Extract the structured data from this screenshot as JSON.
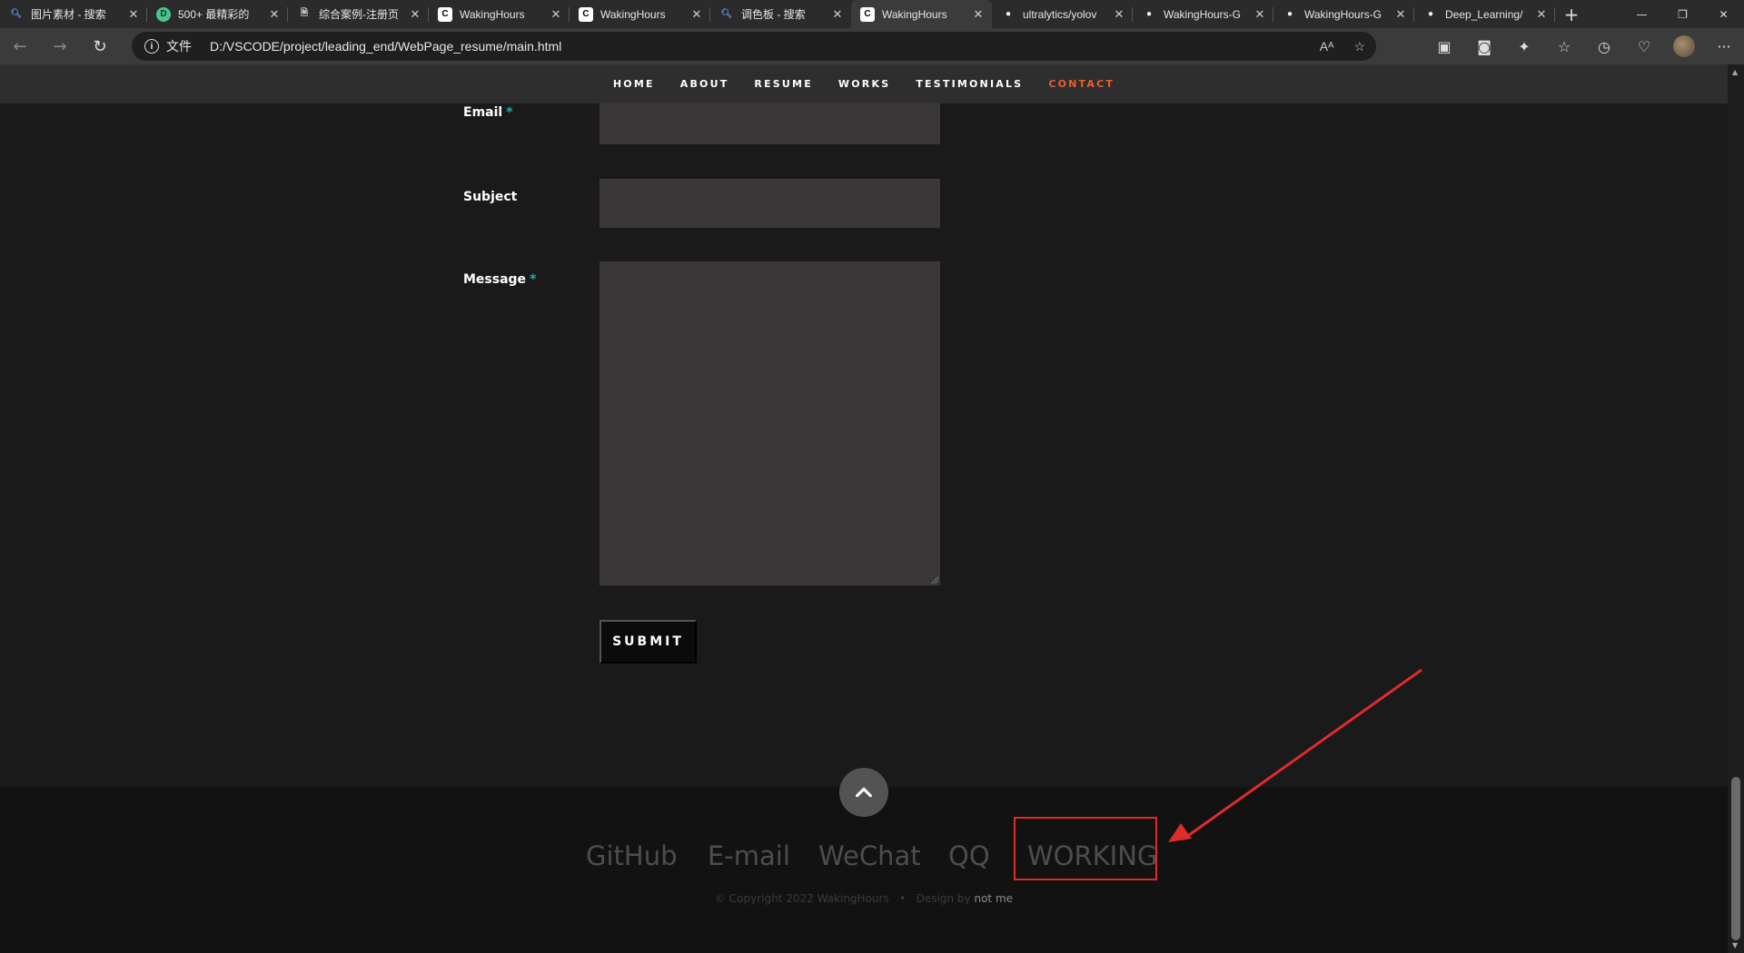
{
  "browser": {
    "tabs": [
      {
        "title": "图片素材 - 搜索",
        "icon": "search-icon"
      },
      {
        "title": "500+ 最精彩的",
        "icon": "d-icon"
      },
      {
        "title": "综合案例-注册页",
        "icon": "document-icon"
      },
      {
        "title": "WakingHours",
        "icon": "c-icon"
      },
      {
        "title": "WakingHours",
        "icon": "c-icon"
      },
      {
        "title": "调色板 - 搜索",
        "icon": "search-icon"
      },
      {
        "title": "WakingHours",
        "icon": "c-icon",
        "active": true
      },
      {
        "title": "ultralytics/yolov",
        "icon": "github-icon"
      },
      {
        "title": "WakingHours-G",
        "icon": "github-icon"
      },
      {
        "title": "WakingHours-G",
        "icon": "github-icon"
      },
      {
        "title": "Deep_Learning/",
        "icon": "github-icon"
      }
    ],
    "address": {
      "protocol_label": "文件",
      "url": "D:/VSCODE/project/leading_end/WebPage_resume/main.html"
    }
  },
  "nav": {
    "items": [
      "HOME",
      "ABOUT",
      "RESUME",
      "WORKS",
      "TESTIMONIALS",
      "CONTACT"
    ],
    "current": "CONTACT",
    "accent": "#e8602c"
  },
  "form": {
    "email_label": "Email",
    "subject_label": "Subject",
    "message_label": "Message",
    "required_mark": "*",
    "submit_label": "SUBMIT"
  },
  "footer": {
    "social": [
      "GitHub",
      "E-mail",
      "WeChat",
      "QQ",
      "WORKING"
    ],
    "copyright": "© Copyright 2022 WakingHours",
    "separator": "•",
    "design_by": "Design by",
    "designer": "not me"
  },
  "colors": {
    "page_bg": "#1a1a1b",
    "footer_bg": "#121212",
    "field_bg": "#3b3738",
    "required": "#13b5b1",
    "annotation": "#e02b2b"
  }
}
